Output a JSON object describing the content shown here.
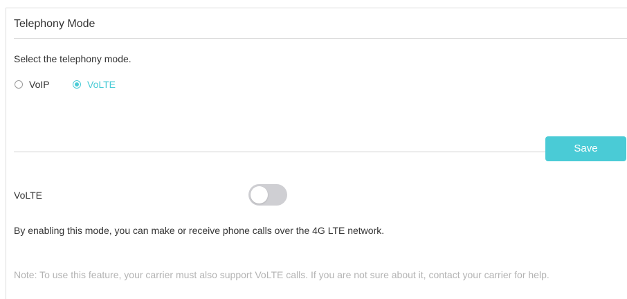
{
  "section": {
    "title": "Telephony Mode",
    "instruction": "Select the telephony mode.",
    "options": [
      {
        "label": "VoIP",
        "checked": false
      },
      {
        "label": "VoLTE",
        "checked": true
      }
    ],
    "save_label": "Save"
  },
  "volte": {
    "label": "VoLTE",
    "enabled": false,
    "description": "By enabling this mode, you can make or receive phone calls over the 4G LTE network.",
    "note": "Note: To use this feature, your carrier must also support VoLTE calls. If you are not sure about it, contact your carrier for help."
  },
  "colors": {
    "accent": "#4acbd6",
    "text": "#333333",
    "muted": "#b3b3b3",
    "toggle_off": "#cfcfd3"
  }
}
